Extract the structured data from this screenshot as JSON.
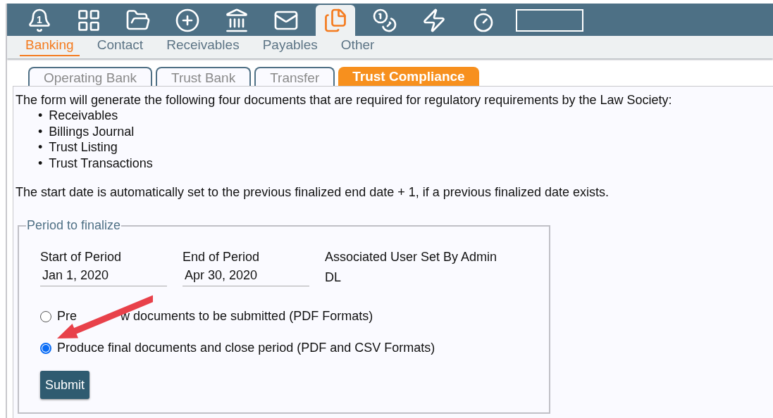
{
  "toolbar": {
    "icons": [
      {
        "selected": false,
        "badge": "1"
      },
      {
        "selected": false
      },
      {
        "selected": false
      },
      {
        "selected": false
      },
      {
        "selected": false
      },
      {
        "selected": false
      },
      {
        "selected": true
      },
      {
        "selected": false
      },
      {
        "selected": false
      },
      {
        "selected": false
      }
    ]
  },
  "nav": [
    {
      "label": "Banking",
      "selected": true
    },
    {
      "label": "Contact",
      "selected": false
    },
    {
      "label": "Receivables",
      "selected": false
    },
    {
      "label": "Payables",
      "selected": false
    },
    {
      "label": "Other",
      "selected": false
    }
  ],
  "tabs": [
    {
      "label": "Operating Bank",
      "selected": false
    },
    {
      "label": "Trust Bank",
      "selected": false
    },
    {
      "label": "Transfer",
      "selected": false
    },
    {
      "label": "Trust Compliance",
      "selected": true
    }
  ],
  "intro": "The form will generate the following four documents that are required for regulatory requirements by the Law Society:",
  "documents": [
    {
      "bullet": "•",
      "text": "Receivables"
    },
    {
      "bullet": "•",
      "text": "Billings Journal"
    },
    {
      "bullet": "•",
      "text": "Trust Listing"
    },
    {
      "bullet": "•",
      "text": "Trust Transactions"
    }
  ],
  "note": "The start date is automatically set to the previous finalized end date + 1, if a previous finalized date exists.",
  "period": {
    "legend": "Period to finalize",
    "fields": [
      {
        "label": "Start of Period",
        "value": "Jan 1, 2020"
      },
      {
        "label": "End of Period",
        "value": "Apr 30, 2020"
      }
    ],
    "user": {
      "label": "Associated User Set By Admin",
      "value": "DL"
    },
    "options": [
      {
        "label_parts": [
          "Pre",
          "w documents to be submitted (PDF Formats)"
        ],
        "selected": false
      },
      {
        "label_parts": [
          "Produce final documents and close period (PDF and CSV Formats)"
        ],
        "selected": true
      }
    ],
    "submit": "Submit"
  }
}
